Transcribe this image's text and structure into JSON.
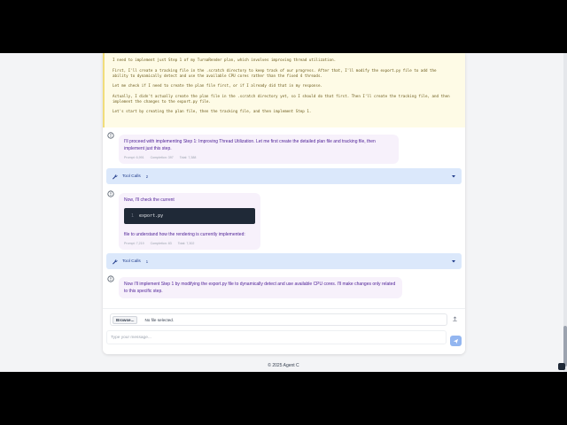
{
  "thinking": {
    "lines": [
      "I need to implement just Step 1 of my TurnaRender plan, which involves improving thread utilization.",
      "First, I'll create a tracking file in the .scratch directory to keep track of our progress. After that, I'll modify the export.py file to add the",
      "ability to dynamically detect and use the available CPU cores rather than the fixed 4 threads.",
      "Let me check if I need to create the plan file first, or if I already did that in my response.",
      "Actually, I didn't actually create the plan file in the .scratch directory yet, so I should do that first. Then I'll create the tracking file, and then",
      "implement the changes to the export.py file.",
      "Let's start by creating the plan file, then the tracking file, and then implement Step 1."
    ]
  },
  "messages": [
    {
      "text": "I'll proceed with implementing Step 1: Improving Thread Utilization. Let me first create the detailed plan file and tracking file, then implement just this step.",
      "prompt": "Prompt: 6,991",
      "completion": "Completion: 397",
      "total": "Total: 7,388"
    },
    {
      "text_before": "Now, I'll check the current",
      "code": "export.py",
      "code_line": "1",
      "text_after": "file to understand how the rendering is currently implemented:",
      "prompt": "Prompt: 7,219",
      "completion": "Completion: 83",
      "total": "Total: 7,302"
    },
    {
      "text": "Now I'll implement Step 1 by modifying the export.py file to dynamically detect and use available CPU cores. I'll make changes only related to this specific step."
    }
  ],
  "tool_calls": [
    {
      "label": "Tool Calls",
      "count": "2"
    },
    {
      "label": "Tool Calls",
      "count": "1"
    }
  ],
  "input": {
    "browse_label": "Browse...",
    "file_status": "No file selected.",
    "placeholder": "Type your message..."
  },
  "footer": {
    "text": "© 2025 Agent C"
  },
  "colors": {
    "thinking_bg": "#fefbe6",
    "assistant_bubble": "#f7f1fb",
    "assistant_text": "#4c1d95",
    "tool_bar": "#dbe8fb",
    "send_button": "#93b6f0"
  }
}
